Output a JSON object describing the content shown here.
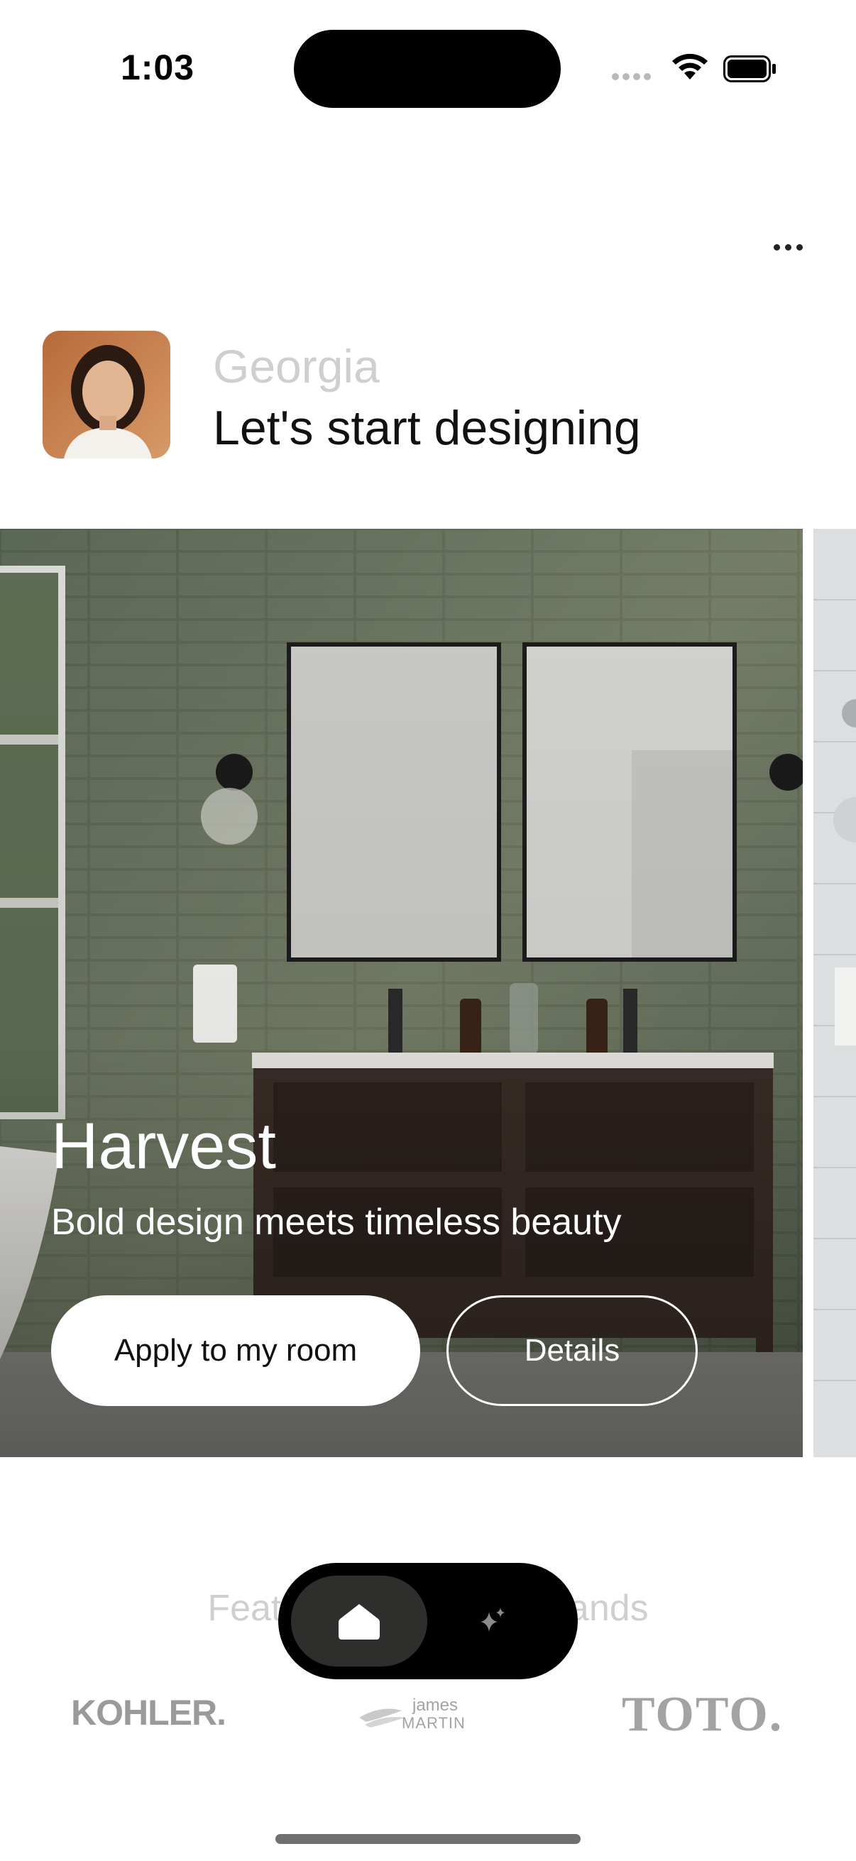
{
  "status_bar": {
    "time": "1:03"
  },
  "header": {
    "user_name": "Georgia",
    "greeting": "Let's start designing"
  },
  "hero": {
    "title": "Harvest",
    "subtitle": "Bold design meets timeless beauty",
    "apply_label": "Apply to my room",
    "details_label": "Details"
  },
  "brands": {
    "heading": "Featuring Premium Brands",
    "logos": [
      "KOHLER.",
      "james MARTIN",
      "TOTO."
    ]
  },
  "tabbar": {
    "items": [
      "home-icon",
      "sparkle-icon"
    ],
    "active": "home"
  }
}
